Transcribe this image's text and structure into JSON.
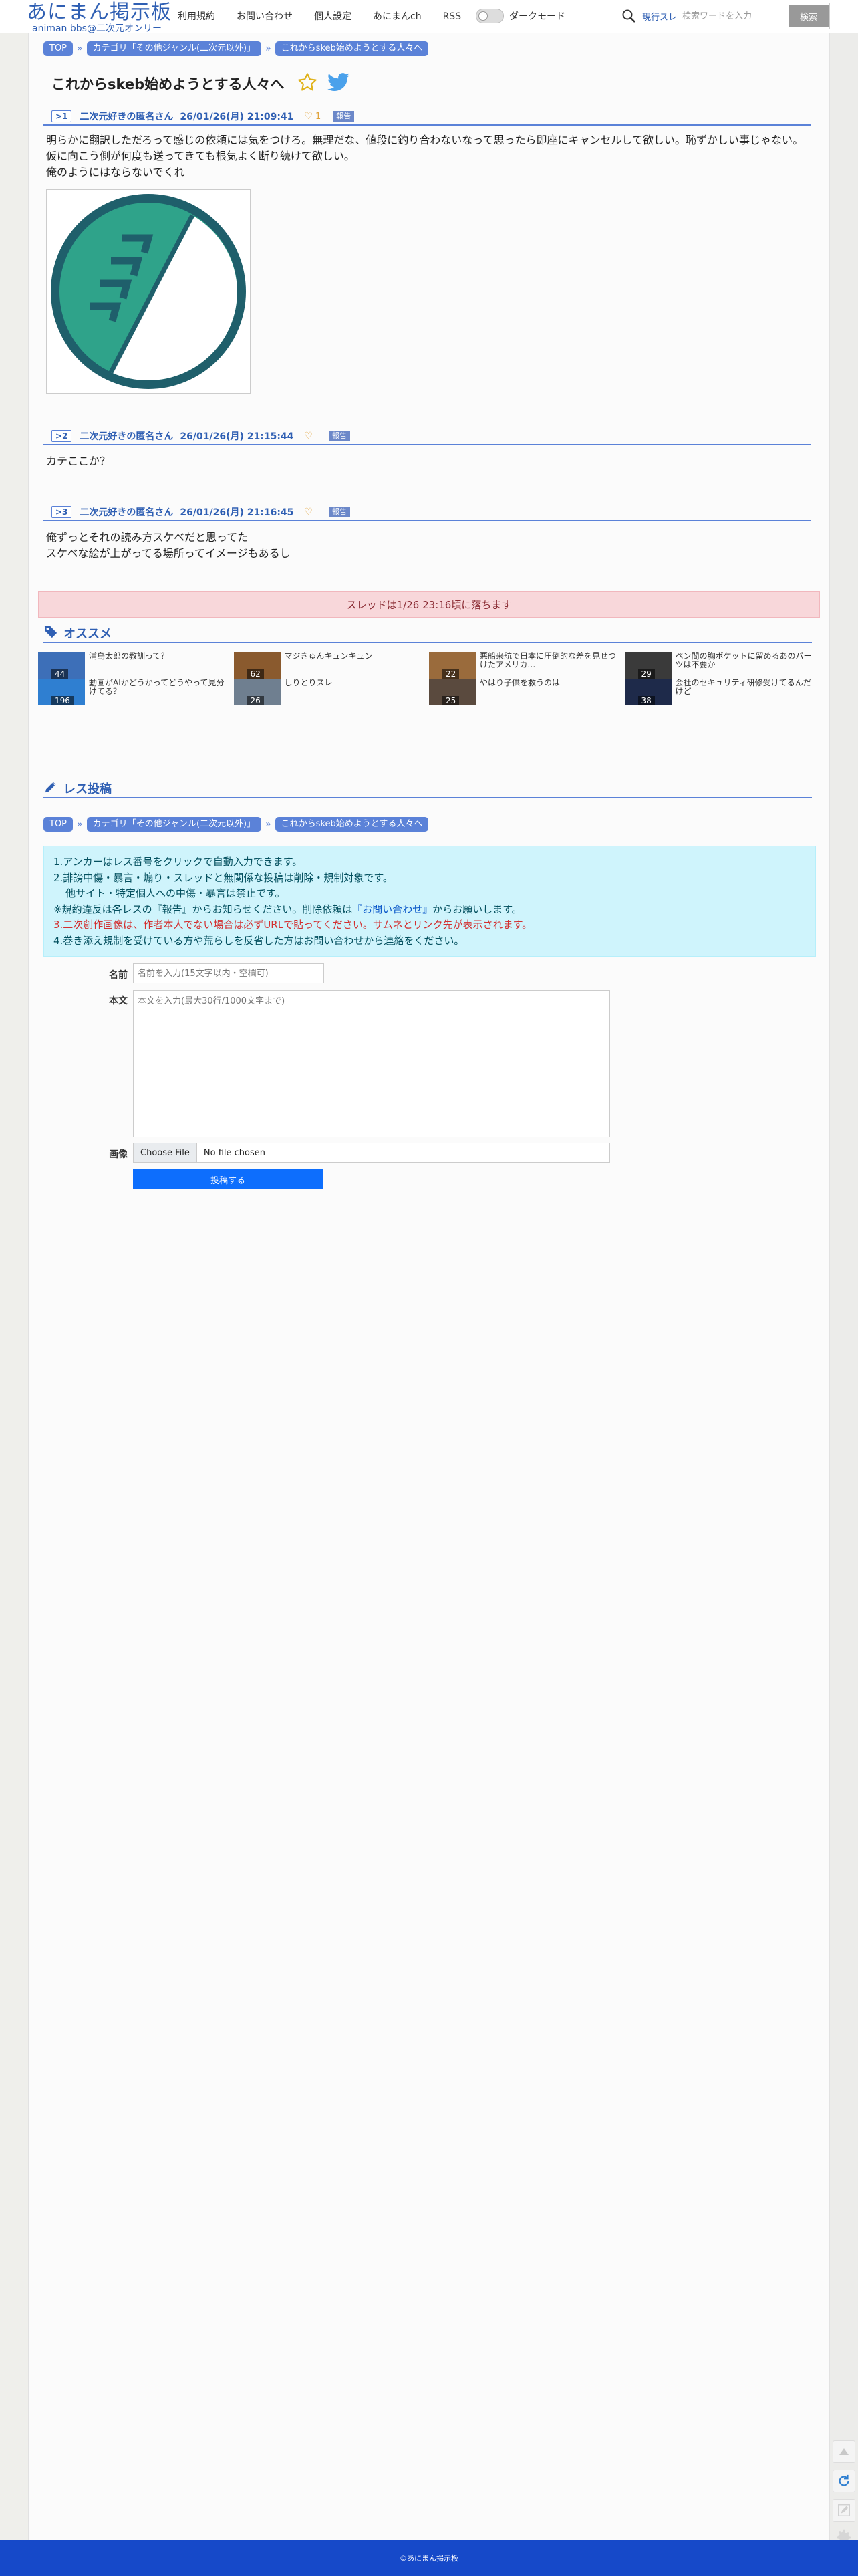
{
  "header": {
    "logo_main": "あにまん掲示板",
    "logo_sub": "animan bbs@二次元オンリー",
    "nav": [
      "利用規約",
      "お問い合わせ",
      "個人設定",
      "あにまんch",
      "RSS"
    ],
    "dark_mode_label": "ダークモード",
    "search_scope": "現行スレ",
    "search_placeholder": "検索ワードを入力",
    "search_button": "検索"
  },
  "breadcrumb": {
    "top": "TOP",
    "category": "カテゴリ「その他ジャンル(二次元以外)」",
    "thread": "これからskeb始めようとする人々へ"
  },
  "thread": {
    "title": "これからskeb始めようとする人々へ"
  },
  "posts": [
    {
      "num": ">1",
      "name": "二次元好きの匿名さん",
      "date": "26/01/26(月) 21:09:41",
      "likes": "1",
      "report": "報告",
      "lines": [
        "明らかに翻訳しただろって感じの依頼には気をつけろ。無理だな、値段に釣り合わないなって思ったら即座にキャンセルして欲しい。恥ずかしい事じゃない。",
        "仮に向こう側が何度も送ってきても根気よく断り続けて欲しい。",
        "俺のようにはならないでくれ"
      ]
    },
    {
      "num": ">2",
      "name": "二次元好きの匿名さん",
      "date": "26/01/26(月) 21:15:44",
      "likes": "",
      "report": "報告",
      "lines": [
        "カテここか？"
      ]
    },
    {
      "num": ">3",
      "name": "二次元好きの匿名さん",
      "date": "26/01/26(月) 21:16:45",
      "likes": "",
      "report": "報告",
      "lines": [
        "俺ずっとそれの読み方スケベだと思ってた",
        "スケベな絵が上がってる場所ってイメージもあるし"
      ]
    }
  ],
  "notice": "スレッドは1/26 23:16頃に落ちます",
  "recommend": {
    "title": "オススメ",
    "items": [
      {
        "title": "浦島太郎の教訓って？",
        "count": "44",
        "color": "#3d6fb8"
      },
      {
        "title": "動画がAIかどうかってどうやって見分けてる？",
        "count": "196",
        "color": "#2f7fd1"
      },
      {
        "title": "マジきゅんキュンキュン",
        "count": "62",
        "color": "#8a5a2e"
      },
      {
        "title": "しりとりスレ",
        "count": "26",
        "color": "#6f7f90"
      },
      {
        "title": "悪船来航で日本に圧倒的な差を見せつけたアメリカ…",
        "count": "22",
        "color": "#9a6b3c"
      },
      {
        "title": "やはり子供を救うのは",
        "count": "25",
        "color": "#5a4a3e"
      },
      {
        "title": "ペン間の胸ポケットに留めるあのパーツは不要か",
        "count": "29",
        "color": "#3a3a3a"
      },
      {
        "title": "会社のセキュリティ研修受けてるんだけど",
        "count": "38",
        "color": "#1e2a4a"
      }
    ]
  },
  "reply": {
    "title": "レス投稿",
    "rules": {
      "r1": "1.アンカーはレス番号をクリックで自動入力できます。",
      "r2": "2.誹謗中傷・暴言・煽り・スレッドと無関係な投稿は削除・規制対象です。",
      "r2b": "他サイト・特定個人への中傷・暴言は禁止です。",
      "r3a": "※規約違反は各レスの『報告』からお知らせください。削除依頼は",
      "r3link": "『お問い合わせ』",
      "r3b": "からお願いします。",
      "r4": "3.二次創作画像は、作者本人でない場合は必ずURLで貼ってください。サムネとリンク先が表示されます。",
      "r5": "4.巻き添え規制を受けている方や荒らしを反省した方はお問い合わせから連絡をください。"
    },
    "name_label": "名前",
    "name_placeholder": "名前を入力(15文字以内・空欄可)",
    "body_label": "本文",
    "body_placeholder": "本文を入力(最大30行/1000文字まで)",
    "image_label": "画像",
    "file_button": "Choose File",
    "file_text": "No file chosen",
    "submit": "投稿する"
  },
  "footer": "©あにまん掲示板",
  "colors": {
    "accent": "#5b82d8",
    "brand": "#2f5fb3",
    "footer": "#1649c9",
    "submit": "#0d6efd"
  }
}
